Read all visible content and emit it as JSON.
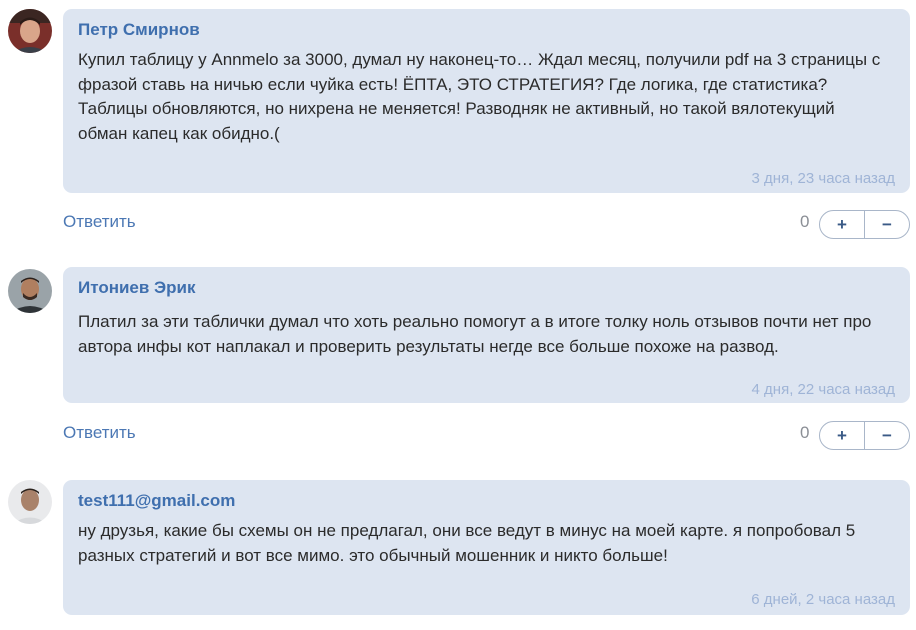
{
  "comments": [
    {
      "author": "Петр Смирнов",
      "text": "Купил таблицу у Annmelo за 3000, думал ну наконец-то… Ждал месяц, получили pdf на 3 страницы с фразой ставь на ничью если чуйка есть! ЁПТА, ЭТО СТРАТЕГИЯ? Где логика, где статистика? Таблицы обновляются, но нихрена не меняется! Разводняк не активный, но такой вялотекущий обман капец как обидно.(",
      "time": "3 дня, 23 часа назад",
      "reply": "Ответить",
      "score": "0",
      "plus": "+",
      "minus": "−"
    },
    {
      "author": "Итониев Эрик",
      "text": "Платил за эти таблички думал что хоть реально помогут а в итоге толку ноль отзывов почти нет про автора инфы кот наплакал и проверить результаты негде все больше похоже на развод.",
      "time": "4 дня, 22 часа назад",
      "reply": "Ответить",
      "score": "0",
      "plus": "+",
      "minus": "−"
    },
    {
      "author": "test111@gmail.com",
      "text": "ну друзья, какие бы схемы он не предлагал, они все ведут в минус на моей карте. я попробовал 5 разных стратегий и вот все мимо. это обычный мошенник и никто больше!",
      "time": "6 дней, 2 часа назад"
    }
  ],
  "colors": {
    "bubble": "#dde5f1",
    "author": "#3f6fae",
    "link": "#4c78b4",
    "timestamp": "#9fb4d6"
  }
}
